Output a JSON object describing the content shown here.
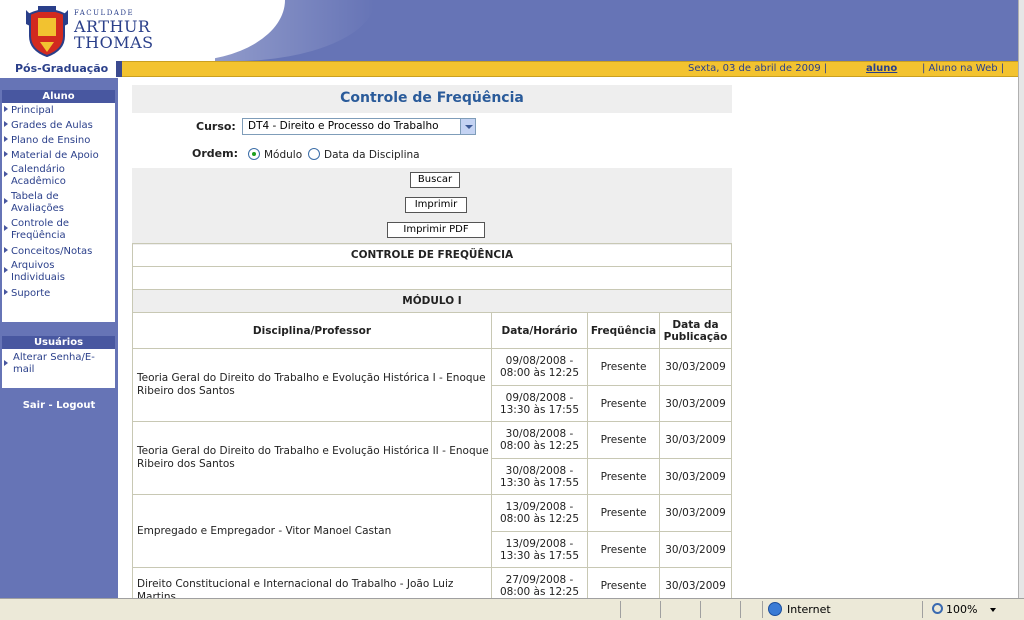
{
  "brand": {
    "small": "FACULDADE",
    "line1": "ARTHUR",
    "line2": "THOMAS"
  },
  "topbar": {
    "section": "Pós-Graduação",
    "date": "Sexta, 03 de abril de 2009 |",
    "user": "aluno",
    "alunoweb": "| Aluno na Web |"
  },
  "sidebar": {
    "aluno_header": "Aluno",
    "aluno_items": [
      {
        "label": "Principal"
      },
      {
        "label": "Grades de Aulas"
      },
      {
        "label": "Plano de Ensino"
      },
      {
        "label": "Material de Apoio"
      },
      {
        "label": "Calendário Acadêmico"
      },
      {
        "label": "Tabela de Avaliações"
      },
      {
        "label": "Controle de Freqüência"
      },
      {
        "label": "Conceitos/Notas"
      },
      {
        "label": "Arquivos Individuais"
      },
      {
        "label": "Suporte"
      }
    ],
    "usuarios_header": "Usuários",
    "usuarios_items": [
      {
        "label": "Alterar Senha/E-mail"
      }
    ],
    "logout": "Sair - Logout"
  },
  "main": {
    "title": "Controle de Freqüência",
    "curso_label": "Curso:",
    "curso_value": "DT4 - Direito e Processo do Trabalho",
    "ordem_label": "Ordem:",
    "ordem_options": [
      {
        "label": "Módulo",
        "selected": true
      },
      {
        "label": "Data da Disciplina",
        "selected": false
      }
    ],
    "buttons": {
      "buscar": "Buscar",
      "imprimir": "Imprimir",
      "imprimir_pdf": "Imprimir PDF"
    }
  },
  "table": {
    "title": "CONTROLE DE FREQÜÊNCIA",
    "module": "MÓDULO I",
    "headers": {
      "discipline": "Disciplina/Professor",
      "datetime": "Data/Horário",
      "frequency": "Freqüência",
      "published": "Data da Publicação"
    },
    "rows": [
      {
        "discipline": "Teoria Geral do Direito do Trabalho e Evolução Histórica I - Enoque Ribeiro dos Santos",
        "sessions": [
          {
            "date": "09/08/2008 -",
            "time": "08:00 às 12:25",
            "status": "Presente",
            "published": "30/03/2009"
          },
          {
            "date": "09/08/2008 -",
            "time": "13:30 às 17:55",
            "status": "Presente",
            "published": "30/03/2009"
          }
        ]
      },
      {
        "discipline": "Teoria Geral do Direito do Trabalho e Evolução Histórica II - Enoque Ribeiro dos Santos",
        "sessions": [
          {
            "date": "30/08/2008 -",
            "time": "08:00 às 12:25",
            "status": "Presente",
            "published": "30/03/2009"
          },
          {
            "date": "30/08/2008 -",
            "time": "13:30 às 17:55",
            "status": "Presente",
            "published": "30/03/2009"
          }
        ]
      },
      {
        "discipline": "Empregado e Empregador - Vitor Manoel Castan",
        "sessions": [
          {
            "date": "13/09/2008 -",
            "time": "08:00 às 12:25",
            "status": "Presente",
            "published": "30/03/2009"
          },
          {
            "date": "13/09/2008 -",
            "time": "13:30 às 17:55",
            "status": "Presente",
            "published": "30/03/2009"
          }
        ]
      },
      {
        "discipline": "Direito Constitucional e Internacional do Trabalho - João Luiz Martins",
        "sessions": [
          {
            "date": "27/09/2008 -",
            "time": "08:00 às 12:25",
            "status": "Presente",
            "published": "30/03/2009"
          }
        ]
      }
    ]
  },
  "statusbar": {
    "zone": "Internet",
    "zoom": "100%"
  }
}
